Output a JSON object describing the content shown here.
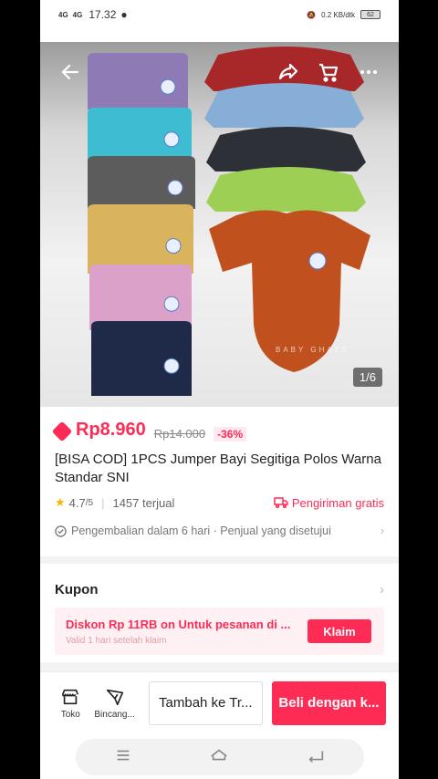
{
  "status": {
    "signal_1": "4G",
    "signal_2": "4G",
    "time": "17.32",
    "net_speed": "0.2 KB/dtk",
    "battery": "62"
  },
  "hero": {
    "watermark": "BABY GHAZZ",
    "counter": "1/6",
    "icons": [
      "back-arrow-icon",
      "share-icon",
      "cart-icon",
      "more-icon"
    ]
  },
  "product": {
    "price": "Rp8.960",
    "old_price": "Rp14.000",
    "discount": "-36%",
    "title": "[BISA COD] 1PCS Jumper Bayi Segitiga Polos Warna Standar SNI",
    "rating": "4.7",
    "rating_max": "/5",
    "sold": "1457 terjual",
    "free_shipping": "Pengiriman gratis",
    "policy": "Pengembalian dalam 6 hari · Penjual yang disetujui"
  },
  "kupon": {
    "label": "Kupon",
    "coupon_title": "Diskon Rp 11RB on Untuk pesanan di ...",
    "coupon_sub": "Valid 1 hari setelah klaim",
    "claim_label": "Klaim"
  },
  "bottom": {
    "toko_label": "Toko",
    "chat_label": "Bincang...",
    "add_cart_label": "Tambah ke Tr...",
    "buy_label": "Beli dengan k..."
  },
  "colors": {
    "accent": "#fe2c55",
    "onesies": [
      "#8e7bb5",
      "#3dbcd2",
      "#5c5c5c",
      "#d9b45c",
      "#dca1c8",
      "#1f2a48",
      "#a8282a",
      "#86aed6",
      "#2e3038",
      "#9ccf54",
      "#c0501e"
    ]
  }
}
